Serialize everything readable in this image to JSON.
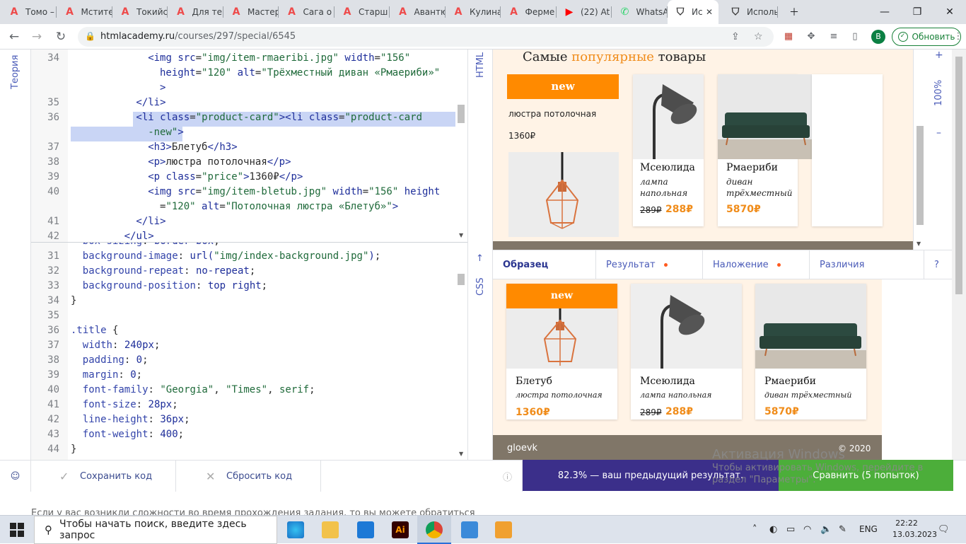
{
  "browser": {
    "tabs": [
      {
        "label": "Томо –",
        "icon": "htmlacademy-icon"
      },
      {
        "label": "Мстите",
        "icon": "htmlacademy-icon"
      },
      {
        "label": "Токийс",
        "icon": "htmlacademy-icon"
      },
      {
        "label": "Для те",
        "icon": "htmlacademy-icon"
      },
      {
        "label": "Мастер",
        "icon": "htmlacademy-icon"
      },
      {
        "label": "Сага о",
        "icon": "htmlacademy-icon"
      },
      {
        "label": "Старш",
        "icon": "htmlacademy-icon"
      },
      {
        "label": "Авантю",
        "icon": "htmlacademy-icon"
      },
      {
        "label": "Кулина",
        "icon": "htmlacademy-icon"
      },
      {
        "label": "Ферме",
        "icon": "htmlacademy-icon"
      },
      {
        "label": "(22) At",
        "icon": "youtube-icon"
      },
      {
        "label": "WhatsA",
        "icon": "whatsapp-icon"
      },
      {
        "label": "Ис",
        "icon": "shield-icon",
        "active": true
      },
      {
        "label": "Исполь",
        "icon": "shield-icon"
      }
    ],
    "url_host": "htmlacademy.ru",
    "url_path": "/courses/297/special/6545",
    "avatar_letter": "В",
    "update_label": "Обновить"
  },
  "sidebar": {
    "theory_label": "Теория"
  },
  "editor": {
    "html_label": "HTML",
    "css_label": "CSS",
    "html_lines": [
      {
        "n": "34",
        "segments": [
          [
            "tg",
            "<img "
          ],
          [
            "at",
            "src"
          ],
          [
            "",
            "="
          ],
          [
            "st",
            "\"img/item-rmaeribi.jpg\""
          ],
          [
            "",
            " "
          ],
          [
            "at",
            "width"
          ],
          [
            "",
            "="
          ],
          [
            "st",
            "\"156\""
          ]
        ]
      },
      {
        "n": "",
        "segments": [
          [
            "at",
            "height"
          ],
          [
            "",
            "="
          ],
          [
            "st",
            "\"120\""
          ],
          [
            "",
            " "
          ],
          [
            "at",
            "alt"
          ],
          [
            "",
            "="
          ],
          [
            "st",
            "\"Трёхместный диван «Рмаериби»\""
          ]
        ]
      },
      {
        "n": "",
        "segments": [
          [
            "tg",
            ">"
          ]
        ]
      },
      {
        "n": "35",
        "segments": [
          [
            "tg",
            "</li>"
          ]
        ]
      },
      {
        "n": "36",
        "segments": [
          [
            "tg",
            "<li "
          ],
          [
            "at",
            "class"
          ],
          [
            "",
            "="
          ],
          [
            "st",
            "\"product-card\""
          ],
          [
            "tg",
            "><li "
          ],
          [
            "at",
            "class"
          ],
          [
            "",
            "="
          ],
          [
            "st",
            "\"product-card"
          ]
        ]
      },
      {
        "n": "",
        "segments": [
          [
            "st",
            "-new\""
          ],
          [
            "tg",
            ">"
          ]
        ]
      },
      {
        "n": "37",
        "segments": [
          [
            "tg",
            "<h3>"
          ],
          [
            "",
            "Блетуб"
          ],
          [
            "tg",
            "</h3>"
          ]
        ]
      },
      {
        "n": "38",
        "segments": [
          [
            "tg",
            "<p>"
          ],
          [
            "",
            "люстра потолочная"
          ],
          [
            "tg",
            "</p>"
          ]
        ]
      },
      {
        "n": "39",
        "segments": [
          [
            "tg",
            "<p "
          ],
          [
            "at",
            "class"
          ],
          [
            "",
            "="
          ],
          [
            "st",
            "\"price\""
          ],
          [
            "tg",
            ">"
          ],
          [
            "",
            "1360₽"
          ],
          [
            "tg",
            "</p>"
          ]
        ]
      },
      {
        "n": "40",
        "segments": [
          [
            "tg",
            "<img "
          ],
          [
            "at",
            "src"
          ],
          [
            "",
            "="
          ],
          [
            "st",
            "\"img/item-bletub.jpg\""
          ],
          [
            "",
            " "
          ],
          [
            "at",
            "width"
          ],
          [
            "",
            "="
          ],
          [
            "st",
            "\"156\""
          ],
          [
            "",
            " "
          ],
          [
            "at",
            "height"
          ]
        ]
      },
      {
        "n": "",
        "segments": [
          [
            "",
            "="
          ],
          [
            "st",
            "\"120\""
          ],
          [
            "",
            " "
          ],
          [
            "at",
            "alt"
          ],
          [
            "",
            "="
          ],
          [
            "st",
            "\"Потолочная люстра «Блетуб»\""
          ],
          [
            "tg",
            ">"
          ]
        ]
      },
      {
        "n": "41",
        "segments": [
          [
            "tg",
            "</li>"
          ]
        ]
      },
      {
        "n": "42",
        "segments": [
          [
            "tg",
            "</ul>"
          ]
        ]
      }
    ],
    "css_lines": [
      {
        "n": "",
        "segments": [
          [
            "pr",
            "box-sizing"
          ],
          [
            "",
            ": "
          ],
          [
            "vl",
            "border-box"
          ],
          [
            "",
            ";"
          ]
        ]
      },
      {
        "n": "31",
        "segments": [
          [
            "pr",
            "background-image"
          ],
          [
            "",
            ": "
          ],
          [
            "vl",
            "url("
          ],
          [
            "st",
            "\"img/index-background.jpg\""
          ],
          [
            "vl",
            ")"
          ],
          [
            "",
            ";"
          ]
        ]
      },
      {
        "n": "32",
        "segments": [
          [
            "pr",
            "background-repeat"
          ],
          [
            "",
            ": "
          ],
          [
            "vl",
            "no-repeat"
          ],
          [
            "",
            ";"
          ]
        ]
      },
      {
        "n": "33",
        "segments": [
          [
            "pr",
            "background-position"
          ],
          [
            "",
            ": "
          ],
          [
            "vl",
            "top right"
          ],
          [
            "",
            ";"
          ]
        ]
      },
      {
        "n": "34",
        "segments": [
          [
            "",
            "}"
          ]
        ]
      },
      {
        "n": "35",
        "segments": [
          [
            "",
            ""
          ]
        ]
      },
      {
        "n": "36",
        "segments": [
          [
            "sl",
            ".title"
          ],
          [
            "",
            " {"
          ]
        ]
      },
      {
        "n": "37",
        "segments": [
          [
            "pr",
            "width"
          ],
          [
            "",
            ": "
          ],
          [
            "nu",
            "240px"
          ],
          [
            "",
            ";"
          ]
        ]
      },
      {
        "n": "38",
        "segments": [
          [
            "pr",
            "padding"
          ],
          [
            "",
            ": "
          ],
          [
            "nu",
            "0"
          ],
          [
            "",
            ";"
          ]
        ]
      },
      {
        "n": "39",
        "segments": [
          [
            "pr",
            "margin"
          ],
          [
            "",
            ": "
          ],
          [
            "nu",
            "0"
          ],
          [
            "",
            ";"
          ]
        ]
      },
      {
        "n": "40",
        "segments": [
          [
            "pr",
            "font-family"
          ],
          [
            "",
            ": "
          ],
          [
            "st",
            "\"Georgia\""
          ],
          [
            "",
            ", "
          ],
          [
            "st",
            "\"Times\""
          ],
          [
            "",
            ", "
          ],
          [
            "st",
            "serif"
          ],
          [
            "",
            ";"
          ]
        ]
      },
      {
        "n": "41",
        "segments": [
          [
            "pr",
            "font-size"
          ],
          [
            "",
            ": "
          ],
          [
            "nu",
            "28px"
          ],
          [
            "",
            ";"
          ]
        ]
      },
      {
        "n": "42",
        "segments": [
          [
            "pr",
            "line-height"
          ],
          [
            "",
            ": "
          ],
          [
            "nu",
            "36px"
          ],
          [
            "",
            ";"
          ]
        ]
      },
      {
        "n": "43",
        "segments": [
          [
            "pr",
            "font-weight"
          ],
          [
            "",
            ": "
          ],
          [
            "nu",
            "400"
          ],
          [
            "",
            ";"
          ]
        ]
      },
      {
        "n": "44",
        "segments": [
          [
            "",
            "}"
          ]
        ]
      }
    ]
  },
  "preview": {
    "title_prefix": "Самые ",
    "title_accent": "популярные",
    "title_suffix": " товары",
    "new_label": "new",
    "card_new_desc": "люстра потолочная",
    "card_new_price": "1360₽",
    "card2_name": "Мсеюлида",
    "card2_desc_1": "лампа",
    "card2_desc_2": "напольная",
    "card2_old": "289₽",
    "card2_price": "288₽",
    "card3_name": "Рмаериби",
    "card3_desc_1": "диван",
    "card3_desc_2": "трёхместный",
    "card3_price": "5870₽",
    "zoom": "100%",
    "zoom_plus": "+",
    "zoom_minus": "–"
  },
  "viewtabs": {
    "sample": "Образец",
    "result": "Результат",
    "overlay": "Наложение",
    "diff": "Различия",
    "help": "?"
  },
  "sample": {
    "new_label": "new",
    "c1_name": "Блетуб",
    "c1_desc": "люстра потолочная",
    "c1_price": "1360₽",
    "c2_name": "Мсеюлида",
    "c2_desc": "лампа напольная",
    "c2_old": "289₽",
    "c2_price": "288₽",
    "c3_name": "Рмаериби",
    "c3_desc": "диван трёхместный",
    "c3_price": "5870₽",
    "footer_brand": "gloevk",
    "footer_copy": "© 2020"
  },
  "bottom": {
    "save": "Сохранить код",
    "reset": "Сбросить код",
    "result": "82.3% — ваш предыдущий результат.",
    "compare": "Сравнить (5 попыток)",
    "help_text": "Если у вас возникли сложности во время прохождения задания, то вы можете обратиться"
  },
  "activation": {
    "title": "Активация Windows",
    "line1": "Чтобы активировать Windows, перейдите в",
    "line2": "раздел \"Параметры\"."
  },
  "taskbar": {
    "search_placeholder": "Чтобы начать поиск, введите здесь запрос",
    "lang": "ENG",
    "time": "22:22",
    "date": "13.03.2023"
  },
  "colors": {
    "accent": "#ff8a00",
    "brand_blue": "#3b2f8a",
    "green": "#4cae3a"
  }
}
